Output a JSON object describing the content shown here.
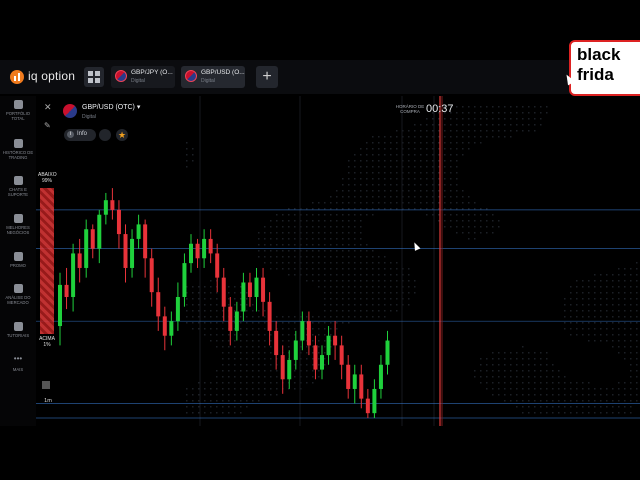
{
  "brand": {
    "name": "iq option"
  },
  "tabs": [
    {
      "name": "GBP/JPY (O...",
      "sub": "Digital",
      "active": false
    },
    {
      "name": "GBP/USD (O...",
      "sub": "Digital",
      "active": true
    }
  ],
  "add_tab_label": "+",
  "promo": {
    "text": "black\nfrida"
  },
  "sidebar": [
    {
      "icon": "portfolio-icon",
      "label": "PORTFÓLIO TOTAL"
    },
    {
      "icon": "history-icon",
      "label": "HISTÓRICO DE TRADING"
    },
    {
      "icon": "chat-icon",
      "label": "CHATS E SUPORTE"
    },
    {
      "icon": "trophy-icon",
      "label": "MELHORES NEGÓCIOS"
    },
    {
      "icon": "fire-icon",
      "label": "PROMO"
    },
    {
      "icon": "analysis-icon",
      "label": "ANÁLISE DO MERCADO"
    },
    {
      "icon": "tutorial-icon",
      "label": "TUTORIAIS"
    },
    {
      "icon": "more-icon",
      "label": "MAIS"
    }
  ],
  "asset": {
    "name": "GBP/USD (OTC) ▾",
    "sub": "Digital",
    "info_label": "Info"
  },
  "timer": {
    "label": "HORÁRIO DE COMPRA",
    "value": "00:37"
  },
  "sentiment": {
    "down_label": "ABAIXO",
    "down_pct": "99%",
    "up_label": "ACIMA",
    "up_pct": "1%"
  },
  "timeframe": "1m",
  "colors": {
    "up": "#1fd13c",
    "down": "#e8333a",
    "line": "#3a7fd8",
    "accent": "#f07b1e"
  },
  "chart_data": {
    "type": "candlestick",
    "candles": [
      [
        0.38,
        0.55,
        0.3,
        0.6
      ],
      [
        0.55,
        0.5,
        0.45,
        0.62
      ],
      [
        0.5,
        0.68,
        0.44,
        0.72
      ],
      [
        0.68,
        0.62,
        0.56,
        0.74
      ],
      [
        0.62,
        0.78,
        0.58,
        0.82
      ],
      [
        0.78,
        0.7,
        0.66,
        0.8
      ],
      [
        0.7,
        0.84,
        0.64,
        0.86
      ],
      [
        0.84,
        0.9,
        0.8,
        0.93
      ],
      [
        0.9,
        0.86,
        0.82,
        0.95
      ],
      [
        0.86,
        0.76,
        0.7,
        0.9
      ],
      [
        0.76,
        0.62,
        0.56,
        0.8
      ],
      [
        0.62,
        0.74,
        0.58,
        0.78
      ],
      [
        0.74,
        0.8,
        0.7,
        0.84
      ],
      [
        0.8,
        0.66,
        0.58,
        0.82
      ],
      [
        0.66,
        0.52,
        0.46,
        0.7
      ],
      [
        0.52,
        0.42,
        0.36,
        0.58
      ],
      [
        0.42,
        0.34,
        0.28,
        0.46
      ],
      [
        0.34,
        0.4,
        0.3,
        0.44
      ],
      [
        0.4,
        0.5,
        0.36,
        0.56
      ],
      [
        0.5,
        0.64,
        0.46,
        0.68
      ],
      [
        0.64,
        0.72,
        0.6,
        0.76
      ],
      [
        0.72,
        0.66,
        0.62,
        0.74
      ],
      [
        0.66,
        0.74,
        0.62,
        0.78
      ],
      [
        0.74,
        0.68,
        0.64,
        0.78
      ],
      [
        0.68,
        0.58,
        0.52,
        0.72
      ],
      [
        0.58,
        0.46,
        0.4,
        0.62
      ],
      [
        0.46,
        0.36,
        0.3,
        0.5
      ],
      [
        0.36,
        0.44,
        0.32,
        0.48
      ],
      [
        0.44,
        0.56,
        0.4,
        0.6
      ],
      [
        0.56,
        0.5,
        0.46,
        0.6
      ],
      [
        0.5,
        0.58,
        0.44,
        0.62
      ],
      [
        0.58,
        0.48,
        0.42,
        0.62
      ],
      [
        0.48,
        0.36,
        0.3,
        0.52
      ],
      [
        0.36,
        0.26,
        0.2,
        0.4
      ],
      [
        0.26,
        0.16,
        0.1,
        0.3
      ],
      [
        0.16,
        0.24,
        0.12,
        0.28
      ],
      [
        0.24,
        0.32,
        0.2,
        0.36
      ],
      [
        0.32,
        0.4,
        0.28,
        0.44
      ],
      [
        0.4,
        0.3,
        0.26,
        0.44
      ],
      [
        0.3,
        0.2,
        0.16,
        0.34
      ],
      [
        0.2,
        0.26,
        0.16,
        0.3
      ],
      [
        0.26,
        0.34,
        0.22,
        0.38
      ],
      [
        0.34,
        0.3,
        0.24,
        0.4
      ],
      [
        0.3,
        0.22,
        0.16,
        0.34
      ],
      [
        0.22,
        0.12,
        0.08,
        0.26
      ],
      [
        0.12,
        0.18,
        0.06,
        0.22
      ],
      [
        0.18,
        0.08,
        0.04,
        0.22
      ],
      [
        0.08,
        0.02,
        0.0,
        0.12
      ],
      [
        0.02,
        0.12,
        0.0,
        0.16
      ],
      [
        0.12,
        0.22,
        0.08,
        0.26
      ],
      [
        0.22,
        0.32,
        0.18,
        0.36
      ]
    ],
    "hlines": [
      0.86,
      0.7,
      0.4,
      0.06,
      0.0
    ]
  }
}
